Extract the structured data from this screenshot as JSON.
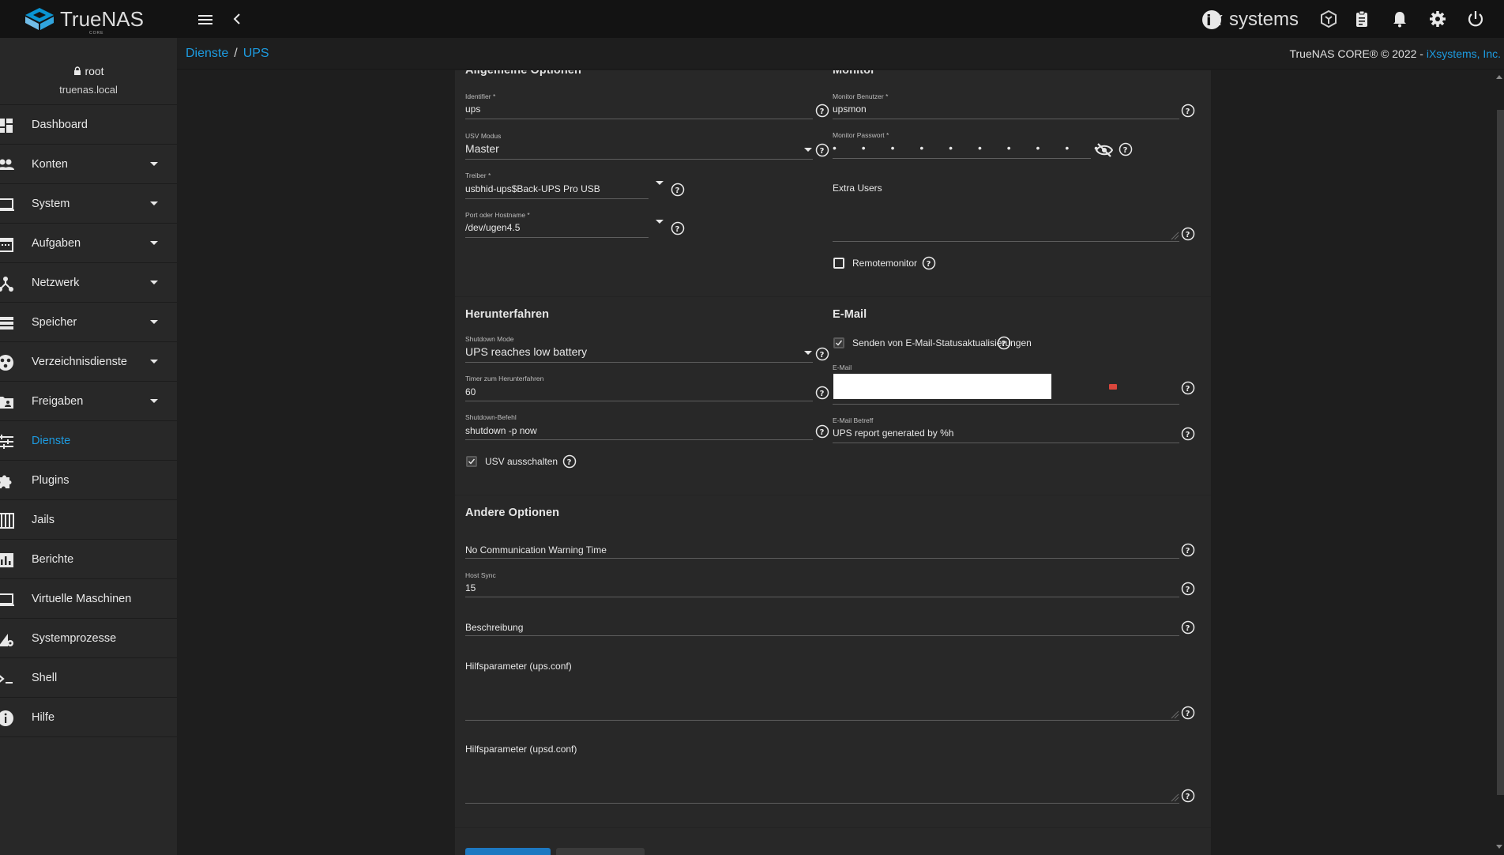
{
  "topbar": {
    "logo_text": "TrueNAS",
    "logo_sub": "CORE",
    "vendor_text": "systems"
  },
  "user": {
    "name": "root",
    "host": "truenas.local"
  },
  "sidebar": {
    "items": [
      {
        "label": "Dashboard",
        "icon": "dashboard-icon",
        "has_caret": false
      },
      {
        "label": "Konten",
        "icon": "people-icon",
        "has_caret": true
      },
      {
        "label": "System",
        "icon": "laptop-icon",
        "has_caret": true
      },
      {
        "label": "Aufgaben",
        "icon": "calendar-icon",
        "has_caret": true
      },
      {
        "label": "Netzwerk",
        "icon": "network-icon",
        "has_caret": true
      },
      {
        "label": "Speicher",
        "icon": "storage-icon",
        "has_caret": true
      },
      {
        "label": "Verzeichnisdienste",
        "icon": "directory-icon",
        "has_caret": true
      },
      {
        "label": "Freigaben",
        "icon": "folder-shared-icon",
        "has_caret": true
      },
      {
        "label": "Dienste",
        "icon": "tune-icon",
        "has_caret": false,
        "active": true
      },
      {
        "label": "Plugins",
        "icon": "puzzle-icon",
        "has_caret": false
      },
      {
        "label": "Jails",
        "icon": "jail-icon",
        "has_caret": false
      },
      {
        "label": "Berichte",
        "icon": "chart-icon",
        "has_caret": false
      },
      {
        "label": "Virtuelle Maschinen",
        "icon": "computer-icon",
        "has_caret": false
      },
      {
        "label": "Systemprozesse",
        "icon": "process-icon",
        "has_caret": false
      },
      {
        "label": "Shell",
        "icon": "terminal-icon",
        "has_caret": false
      },
      {
        "label": "Hilfe",
        "icon": "info-icon",
        "has_caret": false
      }
    ]
  },
  "breadcrumb": {
    "parent": "Dienste",
    "separator": "/",
    "current": "UPS"
  },
  "copyright": {
    "text": "TrueNAS CORE® © 2022 - ",
    "link": "iXsystems, Inc."
  },
  "general": {
    "title": "Allgemeine Optionen",
    "identifier_label": "Identifier *",
    "identifier_value": "ups",
    "mode_label": "USV Modus",
    "mode_value": "Master",
    "driver_label": "Treiber *",
    "driver_value": "usbhid-ups$Back-UPS Pro USB",
    "port_label": "Port oder Hostname *",
    "port_value": "/dev/ugen4.5"
  },
  "monitor": {
    "title": "Monitor",
    "user_label": "Monitor Benutzer *",
    "user_value": "upsmon",
    "password_label": "Monitor Passwort *",
    "password_value": "• • • • • • • • • •",
    "extra_users_label": "Extra Users",
    "remote_label": "Remotemonitor"
  },
  "shutdown": {
    "title": "Herunterfahren",
    "mode_label": "Shutdown Mode",
    "mode_value": "UPS reaches low battery",
    "timer_label": "Timer zum Herunterfahren",
    "timer_value": "60",
    "command_label": "Shutdown-Befehl",
    "command_value": "shutdown -p now",
    "power_off_label": "USV ausschalten"
  },
  "email": {
    "title": "E-Mail",
    "send_label": "Senden von E-Mail-Statusaktualisierungen",
    "email_label": "E-Mail",
    "subject_label": "E-Mail Betreff",
    "subject_value": "UPS report generated by %h"
  },
  "other": {
    "title": "Andere Optionen",
    "nocomm_label": "No Communication Warning Time",
    "hostsync_label": "Host Sync",
    "hostsync_value": "15",
    "description_label": "Beschreibung",
    "aux_ups_label": "Hilfsparameter (ups.conf)",
    "aux_upsd_label": "Hilfsparameter (upsd.conf)"
  },
  "colors": {
    "accent": "#1d9be0",
    "topbar": "#131313",
    "sidebar": "#282828",
    "card": "#282828",
    "error": "#d9463c"
  }
}
